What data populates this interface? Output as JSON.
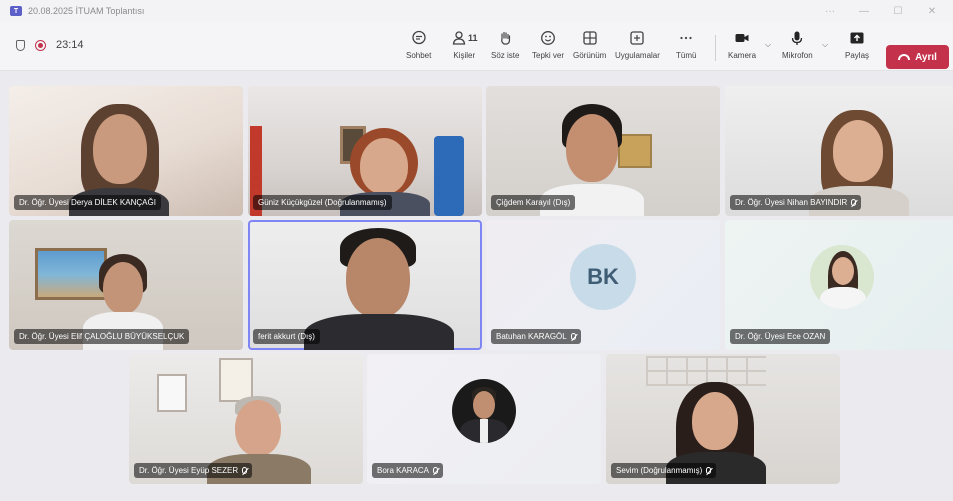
{
  "window": {
    "title": "20.08.2025 İTUAM Toplantısı",
    "app_icon": "teams-logo-icon",
    "controls": [
      "···",
      "—",
      "☐",
      "✕"
    ]
  },
  "meeting": {
    "elapsed": "23:14"
  },
  "toolbar": {
    "chat": "Sohbet",
    "people": "Kişiler",
    "people_count": "11",
    "raise_hand": "Söz iste",
    "react": "Tepki ver",
    "view": "Görünüm",
    "apps": "Uygulamalar",
    "more": "Tümü",
    "camera": "Kamera",
    "mic": "Mikrofon",
    "share": "Paylaş",
    "leave": "Ayrıl"
  },
  "participants": [
    {
      "name": "Dr. Öğr. Üyesi Derya DİLEK KANÇAĞI",
      "muted": false,
      "type": "video"
    },
    {
      "name": "Güniz Küçükgüzel (Doğrulanmamış)",
      "muted": false,
      "type": "video"
    },
    {
      "name": "Çiğdem Karayıl (Dış)",
      "muted": false,
      "type": "video"
    },
    {
      "name": "Dr. Öğr. Üyesi Nihan BAYINDIR",
      "muted": true,
      "type": "video"
    },
    {
      "name": "Dr. Öğr. Üyesi Elif ÇALOĞLU BÜYÜKSELÇUK",
      "muted": false,
      "type": "video"
    },
    {
      "name": "ferit akkurt (Dış)",
      "muted": false,
      "type": "video",
      "active": true
    },
    {
      "name": "Batuhan KARAGÖL",
      "muted": true,
      "type": "initials",
      "initials": "BK"
    },
    {
      "name": "Dr. Öğr. Üyesi Ece OZAN",
      "muted": false,
      "type": "avatar"
    },
    {
      "name": "Dr. Öğr. Üyesi Eyüp SEZER",
      "muted": true,
      "type": "video"
    },
    {
      "name": "Bora KARACA",
      "muted": true,
      "type": "avatar"
    },
    {
      "name": "Sevim (Doğrulanmamış)",
      "muted": true,
      "type": "video"
    }
  ],
  "colors": {
    "accent": "#5b5fc7",
    "leave": "#c4314b",
    "active_border": "#7f85f5"
  }
}
